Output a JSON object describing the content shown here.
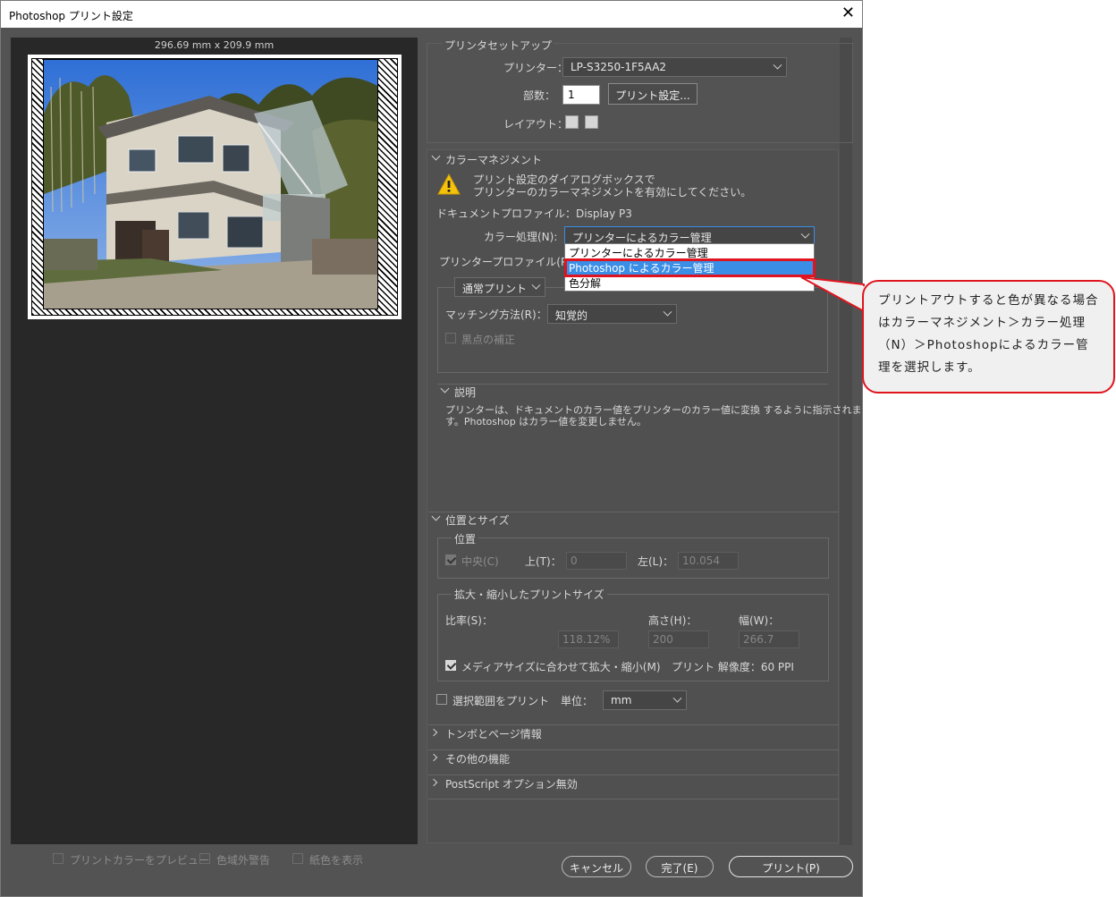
{
  "window": {
    "title": "Photoshop プリント設定"
  },
  "preview": {
    "dimensions": "296.69 mm x 209.9 mm",
    "checkboxes": [
      "プリントカラーをプレビュー",
      "色域外警告",
      "紙色を表示"
    ]
  },
  "printer_setup": {
    "heading": "プリンタセットアップ",
    "printer_label": "プリンター：",
    "printer_value": "LP-S3250-1F5AA2",
    "copies_label": "部数：",
    "copies_value": "1",
    "print_settings_button": "プリント設定...",
    "layout_label": "レイアウト："
  },
  "color_management": {
    "heading": "カラーマネジメント",
    "warning_line1": "プリント設定のダイアログボックスで",
    "warning_line2": "プリンターのカラーマネジメントを有効にしてください。",
    "document_profile": "ドキュメントプロファイル：Display P3",
    "color_handling_label": "カラー処理(N):",
    "color_handling_value": "プリンターによるカラー管理",
    "color_handling_options": [
      "プリンターによるカラー管理",
      "Photoshop によるカラー管理",
      "色分解"
    ],
    "printer_profile_label": "プリンタープロファイル(P)：",
    "normal_print_value": "通常プリント",
    "rendering_label": "マッチング方法(R)：",
    "rendering_value": "知覚的",
    "black_point_label": "黒点の補正"
  },
  "description": {
    "heading": "説明",
    "text_line1": "プリンターは、ドキュメントのカラー値をプリンターのカラー値に変換 するように指示されま",
    "text_line2": "す。Photoshop はカラー値を変更しません。"
  },
  "position_size": {
    "heading": "位置とサイズ",
    "position_heading": "位置",
    "center_label": "中央(C)",
    "top_label": "上(T)：",
    "top_value": "0",
    "left_label": "左(L)：",
    "left_value": "10.054",
    "scaled_heading": "拡大・縮小したプリントサイズ",
    "scale_label": "比率(S)：",
    "height_label": "高さ(H)：",
    "width_label": "幅(W)：",
    "scale_value": "118.12%",
    "height_value": "200",
    "width_value": "266.7",
    "fit_media_label": "メディアサイズに合わせて拡大・縮小(M)",
    "resolution": "プリント 解像度：60 PPI",
    "print_selection_label": "選択範囲をプリント",
    "units_label": "単位：",
    "units_value": "mm"
  },
  "collapsed_sections": [
    "トンボとページ情報",
    "その他の機能",
    "PostScript オプション無効"
  ],
  "buttons": {
    "cancel": "キャンセル",
    "done": "完了(E)",
    "print": "プリント(P)"
  },
  "callout": {
    "text": "プリントアウトすると色が異なる場合はカラーマネジメント＞カラー処理（N）＞Photoshopによるカラー管理を選択します。"
  },
  "colors": {
    "panel_bg": "#535353",
    "preview_bg": "#282828",
    "highlight": "#3a8ee6",
    "annotation_red": "#e0141e"
  }
}
